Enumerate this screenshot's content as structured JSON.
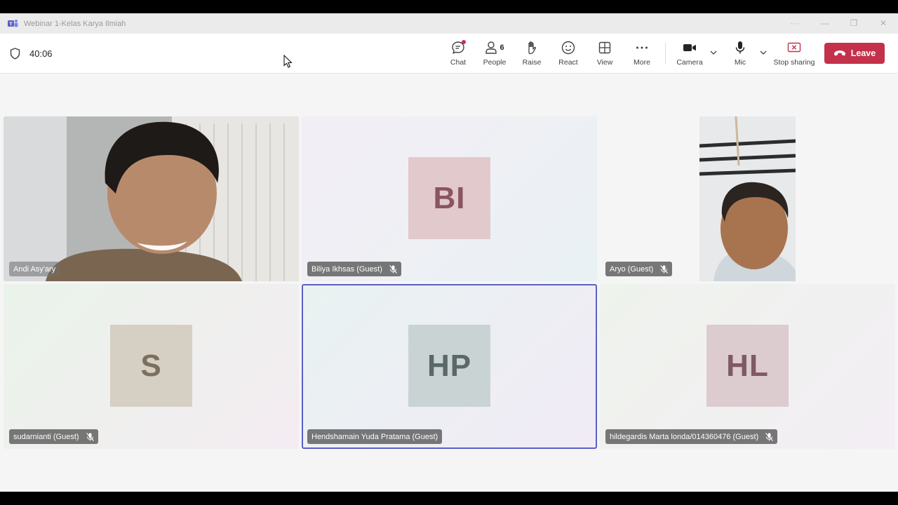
{
  "window": {
    "title": "Webinar 1-Kelas Karya Ilmiah"
  },
  "meeting": {
    "timer": "40:06"
  },
  "toolbar": {
    "chat": "Chat",
    "people": "People",
    "people_count": "6",
    "raise": "Raise",
    "react": "React",
    "view": "View",
    "more": "More",
    "camera": "Camera",
    "mic": "Mic",
    "stop_sharing": "Stop sharing",
    "leave": "Leave"
  },
  "participants": [
    {
      "name": "Andi Asy'ary",
      "initials": "",
      "video": true,
      "muted": false
    },
    {
      "name": "Biliya Ikhsas (Guest)",
      "initials": "BI",
      "video": false,
      "muted": true,
      "avatar_color": "#e2c9cc",
      "initials_color": "#8a5560"
    },
    {
      "name": "Aryo (Guest)",
      "initials": "",
      "video": true,
      "muted": true
    },
    {
      "name": "sudarnianti (Guest)",
      "initials": "S",
      "video": false,
      "muted": true,
      "avatar_color": "#d6cfc3",
      "initials_color": "#7c6f5e"
    },
    {
      "name": "Hendshamain Yuda Pratama (Guest)",
      "initials": "HP",
      "video": false,
      "muted": false,
      "avatar_color": "#c9d3d3",
      "initials_color": "#5a6869"
    },
    {
      "name": "hildegardis Marta londa/014360476 (Guest)",
      "initials": "HL",
      "video": false,
      "muted": true,
      "avatar_color": "#dccbcf",
      "initials_color": "#7e5a64"
    }
  ],
  "colors": {
    "accent": "#5b5fc7",
    "leave": "#c4314b"
  }
}
